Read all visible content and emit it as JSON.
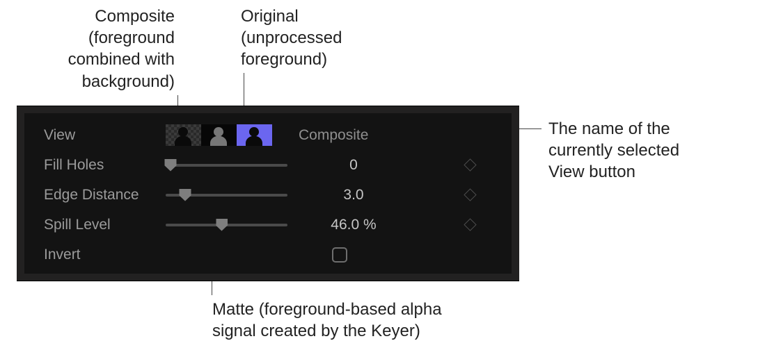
{
  "callouts": {
    "composite": "Composite\n(foreground\ncombined with\nbackground)",
    "original": "Original\n(unprocessed\nforeground)",
    "viewname": "The name of the\ncurrently selected\nView button",
    "matte": "Matte (foreground-based alpha\nsignal created by the Keyer)"
  },
  "panel": {
    "viewLabel": "View",
    "selectedViewName": "Composite",
    "fillHoles": {
      "label": "Fill Holes",
      "value": "0",
      "pos": 4
    },
    "edgeDistance": {
      "label": "Edge Distance",
      "value": "3.0",
      "pos": 16
    },
    "spillLevel": {
      "label": "Spill Level",
      "value": "46.0 %",
      "pos": 46
    },
    "invertLabel": "Invert"
  }
}
